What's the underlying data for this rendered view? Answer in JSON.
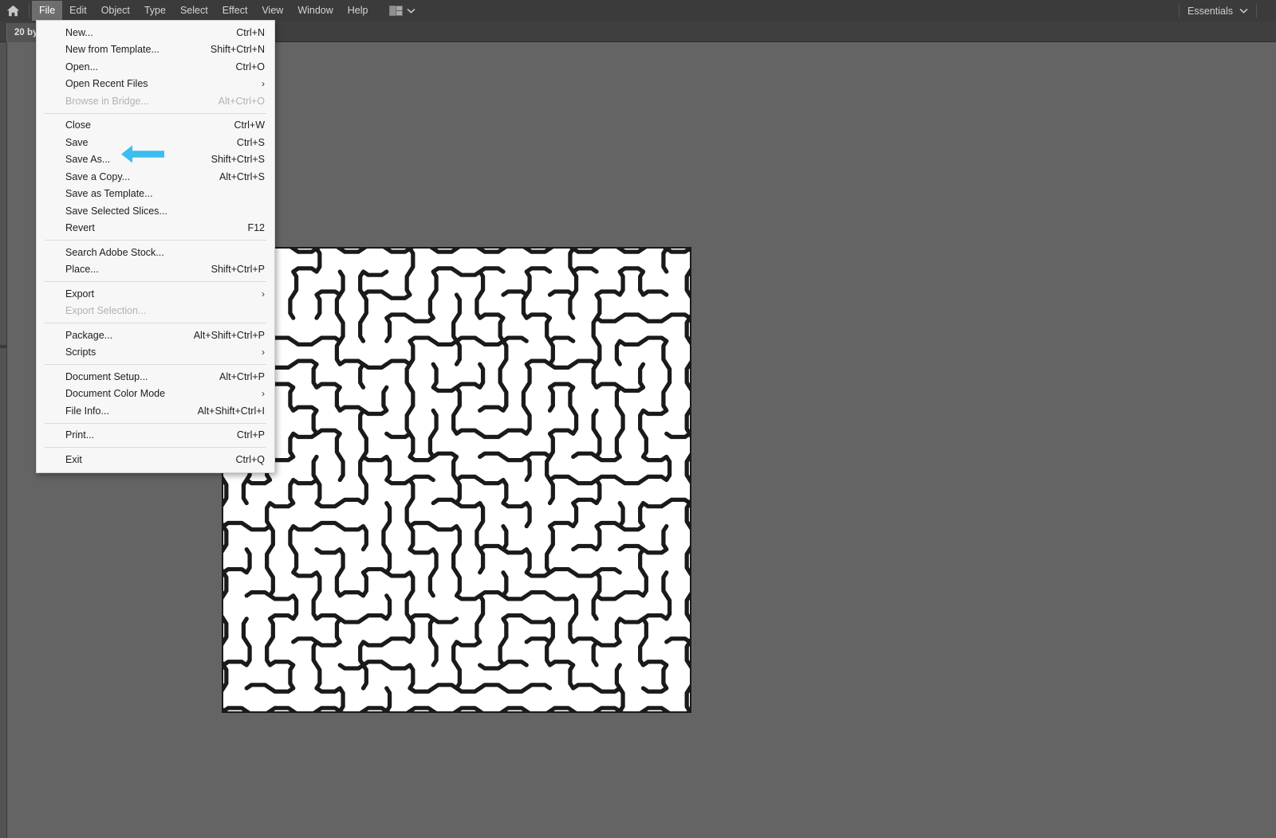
{
  "app": {
    "window_bg": "#646464",
    "chrome_bg": "#3b3b3b",
    "accent_arrow_color": "#3cbdef"
  },
  "menubar": {
    "home_icon": "home-icon",
    "items": [
      {
        "label": "File",
        "active": true
      },
      {
        "label": "Edit",
        "active": false
      },
      {
        "label": "Object",
        "active": false
      },
      {
        "label": "Type",
        "active": false
      },
      {
        "label": "Select",
        "active": false
      },
      {
        "label": "Effect",
        "active": false
      },
      {
        "label": "View",
        "active": false
      },
      {
        "label": "Window",
        "active": false
      },
      {
        "label": "Help",
        "active": false
      }
    ],
    "arrange_icon": "arrange-documents-icon",
    "arrange_chevron": "chevron-down-icon",
    "workspace_label": "Essentials",
    "workspace_chevron": "chevron-down-icon"
  },
  "tabbar": {
    "tabs": [
      {
        "label": "20 by",
        "active": true
      }
    ]
  },
  "file_menu": {
    "groups": [
      {
        "items": [
          {
            "label": "New...",
            "accel": "Ctrl+N",
            "submenu": false,
            "disabled": false
          },
          {
            "label": "New from Template...",
            "accel": "Shift+Ctrl+N",
            "submenu": false,
            "disabled": false
          },
          {
            "label": "Open...",
            "accel": "Ctrl+O",
            "submenu": false,
            "disabled": false
          },
          {
            "label": "Open Recent Files",
            "accel": "",
            "submenu": true,
            "disabled": false
          },
          {
            "label": "Browse in Bridge...",
            "accel": "Alt+Ctrl+O",
            "submenu": false,
            "disabled": true
          }
        ]
      },
      {
        "items": [
          {
            "label": "Close",
            "accel": "Ctrl+W",
            "submenu": false,
            "disabled": false
          },
          {
            "label": "Save",
            "accel": "Ctrl+S",
            "submenu": false,
            "disabled": false
          },
          {
            "label": "Save As...",
            "accel": "Shift+Ctrl+S",
            "submenu": false,
            "disabled": false
          },
          {
            "label": "Save a Copy...",
            "accel": "Alt+Ctrl+S",
            "submenu": false,
            "disabled": false
          },
          {
            "label": "Save as Template...",
            "accel": "",
            "submenu": false,
            "disabled": false
          },
          {
            "label": "Save Selected Slices...",
            "accel": "",
            "submenu": false,
            "disabled": false
          },
          {
            "label": "Revert",
            "accel": "F12",
            "submenu": false,
            "disabled": false
          }
        ]
      },
      {
        "items": [
          {
            "label": "Search Adobe Stock...",
            "accel": "",
            "submenu": false,
            "disabled": false
          },
          {
            "label": "Place...",
            "accel": "Shift+Ctrl+P",
            "submenu": false,
            "disabled": false
          }
        ]
      },
      {
        "items": [
          {
            "label": "Export",
            "accel": "",
            "submenu": true,
            "disabled": false
          },
          {
            "label": "Export Selection...",
            "accel": "",
            "submenu": false,
            "disabled": true
          }
        ]
      },
      {
        "items": [
          {
            "label": "Package...",
            "accel": "Alt+Shift+Ctrl+P",
            "submenu": false,
            "disabled": false
          },
          {
            "label": "Scripts",
            "accel": "",
            "submenu": true,
            "disabled": false
          }
        ]
      },
      {
        "items": [
          {
            "label": "Document Setup...",
            "accel": "Alt+Ctrl+P",
            "submenu": false,
            "disabled": false
          },
          {
            "label": "Document Color Mode",
            "accel": "",
            "submenu": true,
            "disabled": false
          },
          {
            "label": "File Info...",
            "accel": "Alt+Shift+Ctrl+I",
            "submenu": false,
            "disabled": false
          }
        ]
      },
      {
        "items": [
          {
            "label": "Print...",
            "accel": "Ctrl+P",
            "submenu": false,
            "disabled": false
          }
        ]
      },
      {
        "items": [
          {
            "label": "Exit",
            "accel": "Ctrl+Q",
            "submenu": false,
            "disabled": false
          }
        ]
      }
    ],
    "submenu_glyph": "›"
  },
  "annotation": {
    "arrow_icon": "left-arrow-annotation-icon",
    "points_to": "Save As...",
    "color": "#3cbdef"
  },
  "artwork": {
    "name": "hexagonal-maze-artwork",
    "wall_color": "#1a1a1a",
    "background_color": "#ffffff"
  }
}
